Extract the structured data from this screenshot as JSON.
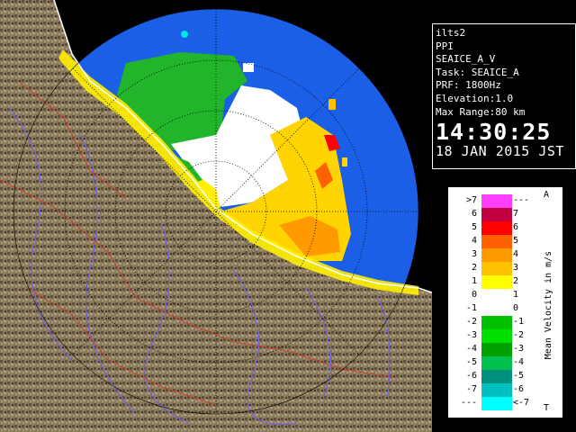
{
  "info": {
    "site": "ilts2",
    "scan_type": "PPI",
    "product": "SEAICE_A_V",
    "task": "Task: SEAICE_A",
    "prf": "PRF: 1800Hz",
    "elevation": "Elevation:1.0",
    "max_range": "Max Range:80 km",
    "time": "14:30:25",
    "date": "18 JAN 2015 JST"
  },
  "legend": {
    "unit_label": "Mean Velocity in m/s",
    "corner_top": "A",
    "corner_bottom": "T",
    "rows": [
      {
        "left": ">7",
        "right": "---",
        "color": "#ff40ff"
      },
      {
        "left": "6",
        "right": "7",
        "color": "#c00040"
      },
      {
        "left": "5",
        "right": "6",
        "color": "#ff0000"
      },
      {
        "left": "4",
        "right": "5",
        "color": "#ff6000"
      },
      {
        "left": "3",
        "right": "4",
        "color": "#ff9a00"
      },
      {
        "left": "2",
        "right": "3",
        "color": "#ffc000"
      },
      {
        "left": "1",
        "right": "2",
        "color": "#ffff00"
      },
      {
        "left": "0",
        "right": "1",
        "color": "#ffffff"
      },
      {
        "left": "-1",
        "right": "0",
        "color": "#ffffff"
      },
      {
        "left": "-2",
        "right": "-1",
        "color": "#00c000"
      },
      {
        "left": "-3",
        "right": "-2",
        "color": "#00e000"
      },
      {
        "left": "-4",
        "right": "-3",
        "color": "#00a000"
      },
      {
        "left": "-5",
        "right": "-4",
        "color": "#00c050"
      },
      {
        "left": "-6",
        "right": "-5",
        "color": "#009080"
      },
      {
        "left": "-7",
        "right": "-6",
        "color": "#00c0c0"
      },
      {
        "left": "---",
        "right": "<-7",
        "color": "#00ffff"
      }
    ]
  },
  "colors": {
    "sea_no_echo": "#1a5fe6",
    "terrain": "#8a7a5e",
    "coast": "#ffffff",
    "rings": "#000000"
  }
}
